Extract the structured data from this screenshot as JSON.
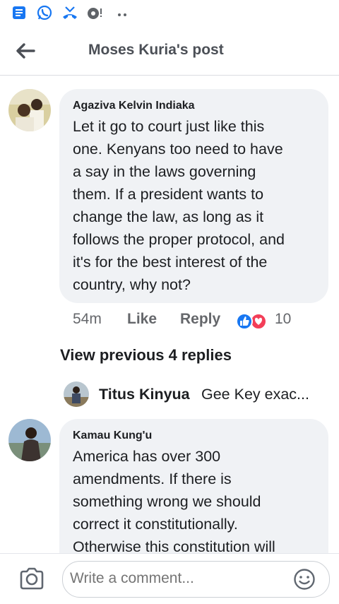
{
  "status_bar": {
    "icons": [
      "news-icon",
      "whatsapp-icon",
      "missed-call-icon",
      "gallery-icon",
      "more-dots-icon"
    ],
    "accent_color": "#1877f2",
    "whatsapp_color": "#25d366"
  },
  "header": {
    "title": "Moses Kuria's post"
  },
  "comments": [
    {
      "author": "Agaziva Kelvin Indiaka",
      "lines": [
        "Let it go to court just like this",
        "one. Kenyans too need to have",
        "a say in the laws governing",
        "them. If a president wants to",
        "change the law, as long as it",
        "follows the proper protocol, and",
        "it's for the best interest of the",
        "country, why not?"
      ],
      "time": "54m",
      "like_label": "Like",
      "reply_label": "Reply",
      "reaction_count": "10"
    },
    {
      "author": "Kamau Kung'u",
      "lines": [
        "America has over 300",
        "amendments. If there is",
        "something wrong we should",
        "correct it constitutionally.",
        "Otherwise this constitution will"
      ]
    }
  ],
  "view_previous": "View previous 4 replies",
  "reply_preview": {
    "author": "Titus Kinyua",
    "text": "Gee Key exac..."
  },
  "compose": {
    "placeholder": "Write a comment..."
  },
  "colors": {
    "bubble": "#f0f2f5",
    "like_blue": "#1877f2",
    "love_red": "#f33e58"
  }
}
